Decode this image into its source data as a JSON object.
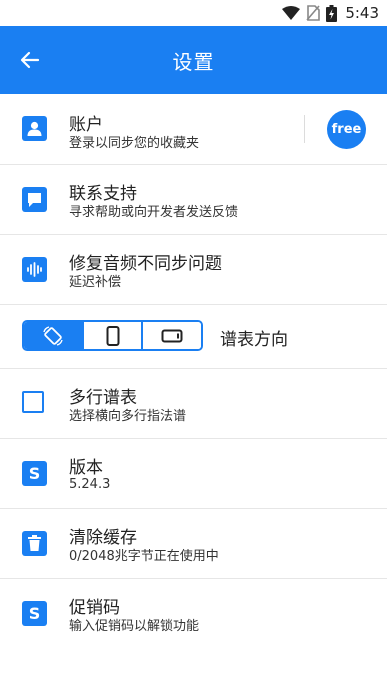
{
  "status": {
    "time": "5:43"
  },
  "header": {
    "title": "设置"
  },
  "account": {
    "title": "账户",
    "subtitle": "登录以同步您的收藏夹",
    "badge": "free"
  },
  "support": {
    "title": "联系支持",
    "subtitle": "寻求帮助或向开发者发送反馈"
  },
  "audio_sync": {
    "title": "修复音频不同步问题",
    "subtitle": "延迟补偿"
  },
  "orientation": {
    "label": "谱表方向",
    "selected": "auto-rotate"
  },
  "multiline": {
    "title": "多行谱表",
    "subtitle": "选择横向多行指法谱",
    "checked": false
  },
  "version": {
    "title": "版本",
    "subtitle": "5.24.3"
  },
  "cache": {
    "title": "清除缓存",
    "subtitle": "0/2048兆字节正在使用中"
  },
  "promo": {
    "title": "促销码",
    "subtitle": "输入促销码以解锁功能"
  },
  "colors": {
    "accent": "#1a7ff2",
    "divider": "#e6e6e6"
  }
}
